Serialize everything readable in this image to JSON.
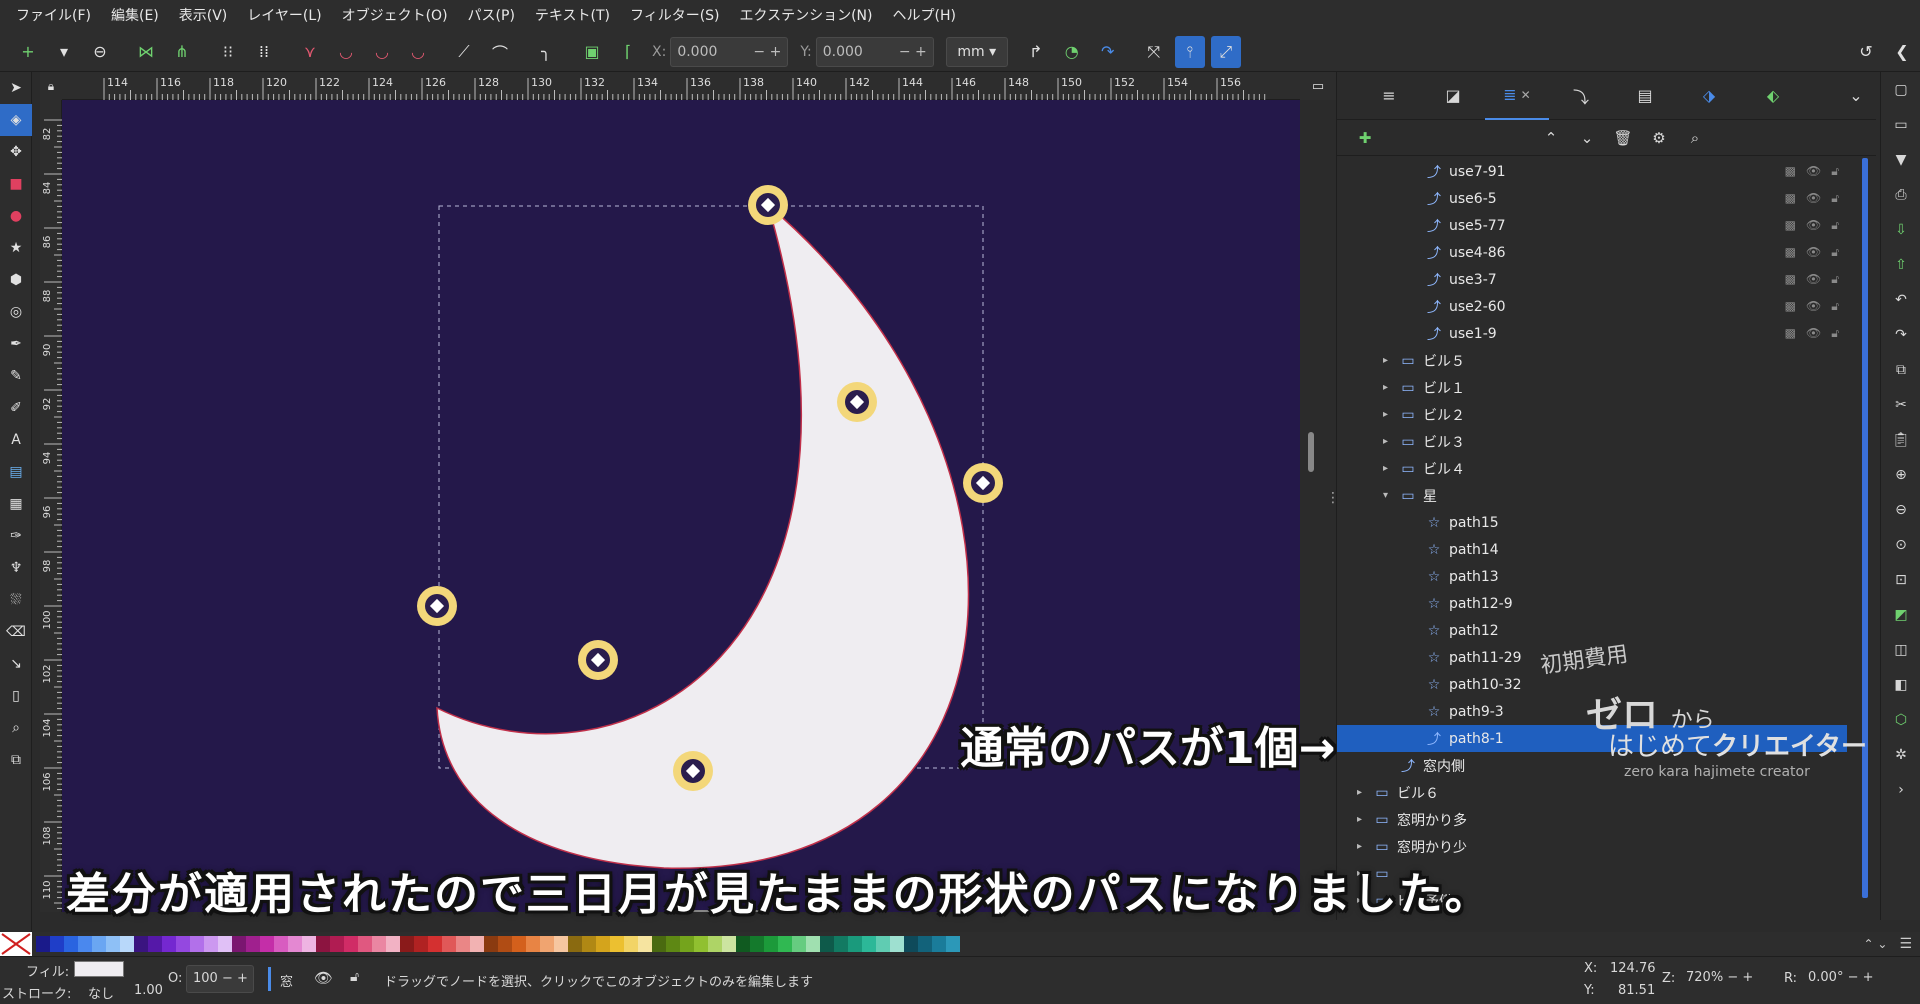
{
  "menu": [
    "ファイル(F)",
    "編集(E)",
    "表示(V)",
    "レイヤー(L)",
    "オブジェクト(O)",
    "パス(P)",
    "テキスト(T)",
    "フィルター(S)",
    "エクステンション(N)",
    "ヘルプ(H)"
  ],
  "toolbar": {
    "x_label": "X:",
    "x_value": "0.000",
    "y_label": "Y:",
    "y_value": "0.000",
    "unit": "mm"
  },
  "ruler_top_ticks": [
    "114",
    "116",
    "118",
    "120",
    "122",
    "124",
    "126",
    "128",
    "130",
    "132",
    "134",
    "136",
    "138",
    "140",
    "142",
    "144",
    "146",
    "148",
    "150",
    "152",
    "154",
    "156"
  ],
  "ruler_left_ticks": [
    "82",
    "84",
    "86",
    "88",
    "90",
    "92",
    "94",
    "96",
    "98",
    "100",
    "102",
    "104",
    "106",
    "108",
    "110"
  ],
  "layers": [
    {
      "label": "use7-91",
      "indent": 3,
      "icon": "clone",
      "ctrls": true
    },
    {
      "label": "use6-5",
      "indent": 3,
      "icon": "clone",
      "ctrls": true
    },
    {
      "label": "use5-77",
      "indent": 3,
      "icon": "clone",
      "ctrls": true
    },
    {
      "label": "use4-86",
      "indent": 3,
      "icon": "clone",
      "ctrls": true
    },
    {
      "label": "use3-7",
      "indent": 3,
      "icon": "clone",
      "ctrls": true
    },
    {
      "label": "use2-60",
      "indent": 3,
      "icon": "clone",
      "ctrls": true
    },
    {
      "label": "use1-9",
      "indent": 3,
      "icon": "clone",
      "ctrls": true
    },
    {
      "label": "ビル５",
      "indent": 2,
      "icon": "folder",
      "arrow": "▸"
    },
    {
      "label": "ビル１",
      "indent": 2,
      "icon": "folder",
      "arrow": "▸"
    },
    {
      "label": "ビル２",
      "indent": 2,
      "icon": "folder",
      "arrow": "▸"
    },
    {
      "label": "ビル３",
      "indent": 2,
      "icon": "folder",
      "arrow": "▸"
    },
    {
      "label": "ビル４",
      "indent": 2,
      "icon": "folder",
      "arrow": "▸"
    },
    {
      "label": "星",
      "indent": 2,
      "icon": "folder",
      "arrow": "▾"
    },
    {
      "label": "path15",
      "indent": 3,
      "icon": "star"
    },
    {
      "label": "path14",
      "indent": 3,
      "icon": "star"
    },
    {
      "label": "path13",
      "indent": 3,
      "icon": "star"
    },
    {
      "label": "path12-9",
      "indent": 3,
      "icon": "star"
    },
    {
      "label": "path12",
      "indent": 3,
      "icon": "star"
    },
    {
      "label": "path11-29",
      "indent": 3,
      "icon": "star"
    },
    {
      "label": "path10-32",
      "indent": 3,
      "icon": "star"
    },
    {
      "label": "path9-3",
      "indent": 3,
      "icon": "star"
    },
    {
      "label": "path8-1",
      "indent": 3,
      "icon": "path",
      "selected": true
    },
    {
      "label": "窓内側",
      "indent": 2,
      "icon": "path"
    },
    {
      "label": "ビル６",
      "indent": 1,
      "icon": "folder",
      "arrow": "▸"
    },
    {
      "label": "窓明かり多",
      "indent": 1,
      "icon": "folder",
      "arrow": "▸"
    },
    {
      "label": "窓明かり少",
      "indent": 1,
      "icon": "folder",
      "arrow": "▸"
    },
    {
      "label": "",
      "indent": 1,
      "icon": "folder",
      "arrow": "▸"
    },
    {
      "label": "ビル予備",
      "indent": 1,
      "icon": "folder",
      "arrow": "▸"
    }
  ],
  "overlay": {
    "callout": "通常のパスが1個→",
    "subtitle": "差分が適用されたので三日月が見たままの形状のパスになりました。",
    "wm_sub": "初期費用",
    "wm_title": "ゼロ",
    "wm_title_small": "から",
    "wm_main_a": "はじめて",
    "wm_main_b": "クリエイター",
    "wm_roman": "zero kara hajimete creator"
  },
  "status": {
    "fill_label": "フィル:",
    "stroke_label": "ストローク:",
    "stroke_value": "なし",
    "stroke_width": "1.00",
    "opacity_label": "O:",
    "opacity_value": "100",
    "layer_name": "窓",
    "message": "ドラッグでノードを選択、クリックでこのオブジェクトのみを編集します",
    "x_label": "X:",
    "x_value": "124.76",
    "y_label": "Y:",
    "y_value": "81.51",
    "zoom_label": "Z:",
    "zoom_value": "720%",
    "rot_label": "R:",
    "rot_value": "0.00°"
  },
  "colors": {
    "canvas": "#24184a",
    "moon_fill": "#efedf1",
    "moon_stroke": "#c1304a",
    "node_ring": "#f3d77a",
    "selection": "#1f5fbf"
  },
  "palette": [
    "#1a1a8a",
    "#1f3ec8",
    "#2a64e0",
    "#4a88ee",
    "#6aa6f2",
    "#8ec0f6",
    "#b8d8fa",
    "#3a1480",
    "#5518a8",
    "#7428d0",
    "#9448e0",
    "#b270ea",
    "#cc98f0",
    "#e0c0f6",
    "#7a1670",
    "#a0208e",
    "#c42ea8",
    "#d85cc0",
    "#e488d2",
    "#eeb4e2",
    "#8c1440",
    "#b01c52",
    "#d02c66",
    "#e05880",
    "#ea86a2",
    "#f2b2c4",
    "#8a1a1a",
    "#b02222",
    "#d43030",
    "#e05858",
    "#ea8686",
    "#f2b2b2",
    "#8a3a10",
    "#b04c14",
    "#d4601c",
    "#e88444",
    "#f0a470",
    "#f6c6a0",
    "#8a6a10",
    "#b08814",
    "#d4a41c",
    "#ecc030",
    "#f2d466",
    "#f6e4a0",
    "#4a6a10",
    "#5e8814",
    "#74a41c",
    "#90c030",
    "#aed466",
    "#cce4a0",
    "#105a20",
    "#147a2c",
    "#1c9a3a",
    "#30b852",
    "#66cc80",
    "#a0e0b0",
    "#0e5a4a",
    "#127a62",
    "#1a9a7c",
    "#2cb898",
    "#60ccb2",
    "#9ee0d0",
    "#0e4a5a",
    "#12627a",
    "#1a7c9a",
    "#2c98b8"
  ]
}
